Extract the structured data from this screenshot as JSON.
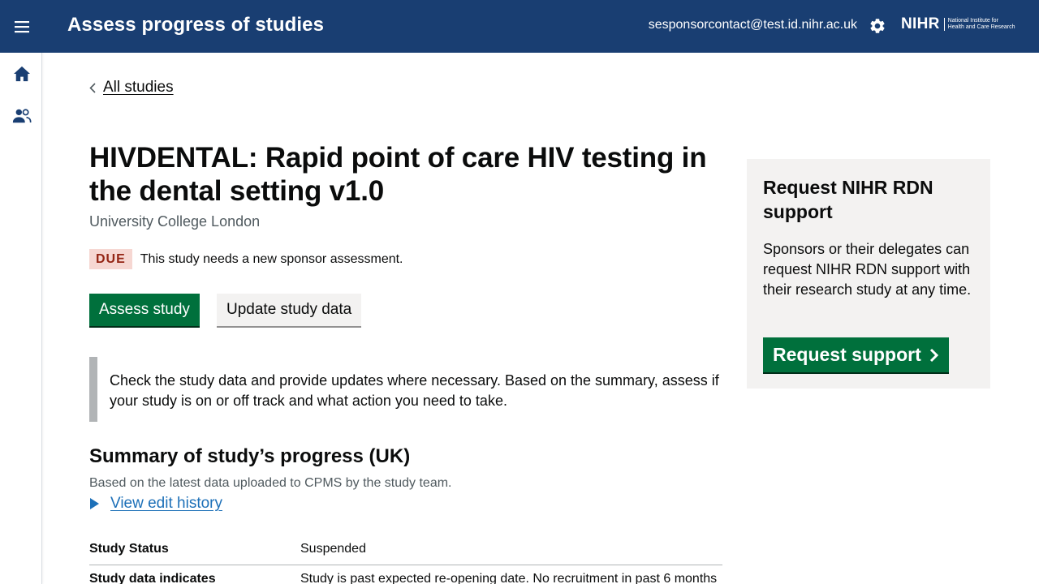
{
  "header": {
    "title": "Assess progress of studies",
    "user_email": "sesponsorcontact@test.id.nihr.ac.uk",
    "logo_mark": "NIHR",
    "logo_text_line1": "National Institute for",
    "logo_text_line2": "Health and Care Research",
    "menu_icon": "menu-icon",
    "settings_icon": "gear-icon"
  },
  "sidenav": {
    "items": [
      {
        "icon": "home-icon"
      },
      {
        "icon": "users-icon"
      }
    ]
  },
  "breadcrumb": {
    "back_label": "All studies"
  },
  "study": {
    "title": "HIVDENTAL: Rapid point of care HIV testing in the dental setting v1.0",
    "organisation": "University College London",
    "status_tag": "DUE",
    "status_text": "This study needs a new sponsor assessment."
  },
  "actions": {
    "assess_label": "Assess study",
    "update_label": "Update study data"
  },
  "inset": {
    "text": "Check the study data and provide updates where necessary. Based on the summary, assess if your study is on or off track and what action you need to take."
  },
  "summary": {
    "heading": "Summary of study’s progress (UK)",
    "subheading": "Based on the latest data uploaded to CPMS by the study team.",
    "history_label": "View edit history",
    "rows": [
      {
        "label": "Study Status",
        "value": "Suspended"
      },
      {
        "label": "Study data indicates",
        "value": "Study is past expected re-opening date. No recruitment in past 6 months"
      }
    ]
  },
  "panel": {
    "title": "Request NIHR RDN support",
    "body": "Sponsors or their delegates can request NIHR RDN support with their research study at any time.",
    "button_label": "Request support"
  },
  "colors": {
    "header_bg": "#193e72",
    "primary_button": "#00703c",
    "due_tag_bg": "#f6d7d2",
    "due_tag_text": "#942514",
    "link": "#1d70b8",
    "panel_bg": "#f3f2f1"
  }
}
